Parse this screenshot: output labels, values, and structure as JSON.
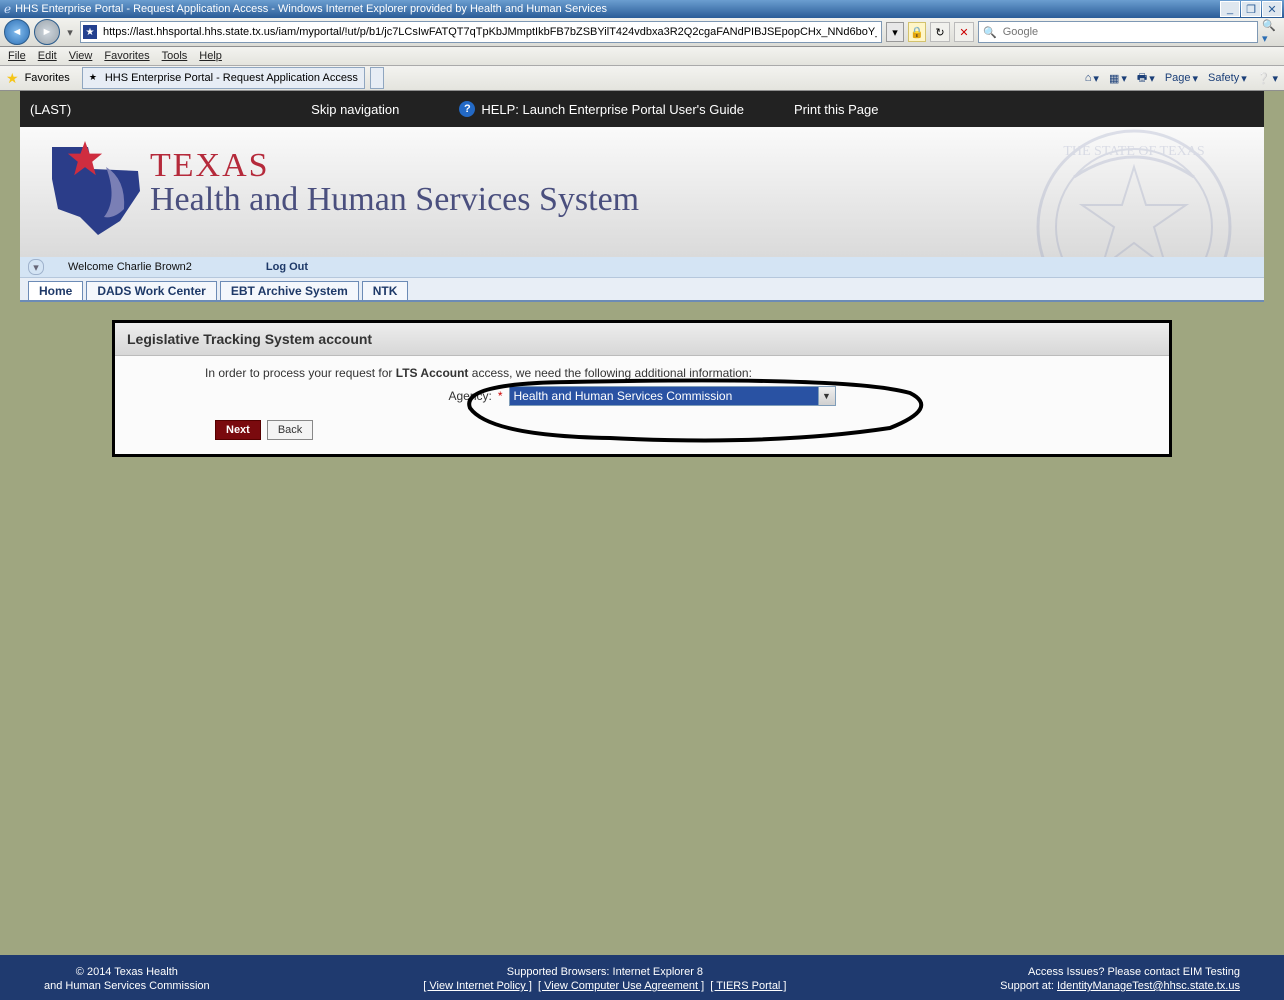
{
  "window": {
    "title": "HHS Enterprise Portal - Request Application Access - Windows Internet Explorer provided by Health and Human Services"
  },
  "addressbar": {
    "url": "https://last.hhsportal.hhs.state.tx.us/iam/myportal/!ut/p/b1/jc7LCsIwFATQT7qTpKbJMmptIkbFB7bZSBYilT424vdbxa3R2Q2cgaFANdPIBJSEpopCHx_NNd6boY_tq",
    "search_placeholder": "Google"
  },
  "menu": [
    "File",
    "Edit",
    "View",
    "Favorites",
    "Tools",
    "Help"
  ],
  "favbar": {
    "favorites": "Favorites",
    "tab_title": "HHS Enterprise Portal - Request Application Access",
    "right": {
      "page": "Page",
      "safety": "Safety"
    }
  },
  "blackbar": {
    "last": "(LAST)",
    "skip": "Skip navigation",
    "help": "HELP: Launch Enterprise Portal User's Guide",
    "print": "Print this Page"
  },
  "logo": {
    "texas": "TEXAS",
    "subtitle": "Health and Human Services System"
  },
  "welcome": {
    "text": "Welcome Charlie Brown2",
    "logout": "Log Out"
  },
  "tabs": [
    "Home",
    "DADS Work Center",
    "EBT Archive System",
    "NTK"
  ],
  "panel": {
    "heading": "Legislative Tracking System account",
    "info_pre": "In order to process your request for ",
    "info_bold": "LTS Account",
    "info_post": " access, we need the following additional information:",
    "agency_label": "Agency:",
    "agency_value": "Health and Human Services Commission",
    "next": "Next",
    "back": "Back"
  },
  "footer": {
    "copyright1": "© 2014 Texas Health",
    "copyright2": "and Human Services Commission",
    "browsers": "Supported Browsers: Internet Explorer 8",
    "link1": "[ View Internet Policy ]",
    "link2": "[ View Computer Use Agreement ]",
    "link3": "[ TIERS Portal ]",
    "access1": "Access Issues? Please contact EIM Testing",
    "access2_pre": "Support at: ",
    "email": "IdentityManageTest@hhsc.state.tx.us"
  }
}
